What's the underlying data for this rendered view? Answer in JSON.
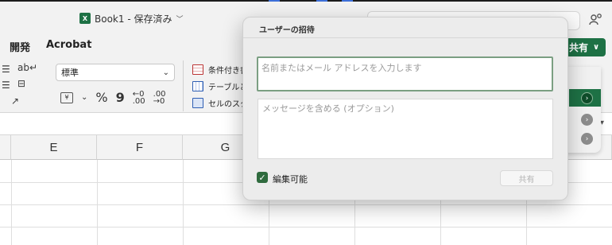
{
  "window": {
    "doc_title": "Book1 - 保存済み",
    "doc_badge": "X"
  },
  "ribbon": {
    "tabs": [
      "開発",
      "Acrobat"
    ],
    "number_format_value": "標準",
    "percent_symbol": "%",
    "comma_symbol": "9",
    "increase_decimal": "←0\n.00",
    "decrease_decimal": ".00\n→0",
    "styles": {
      "conditional": "条件付き書",
      "table": "テーブルと",
      "cell": "セルのスタ"
    },
    "share_label": "共有"
  },
  "grid": {
    "columns": [
      "E",
      "F",
      "G"
    ]
  },
  "invite_dialog": {
    "title": "ユーザーの招待",
    "name_placeholder": "名前またはメール アドレスを入力します",
    "message_placeholder": "メッセージを含める (オプション)",
    "can_edit_label": "編集可能",
    "can_edit_checked": true,
    "share_button_label": "共有"
  },
  "colors": {
    "accent_green": "#1e7145",
    "dialog_bg": "#ececec",
    "input_focus_border": "#7b9f82"
  },
  "icons": {
    "excel_badge": "excel-icon",
    "people": "share-people-icon",
    "checkbox": "checkmark-icon"
  }
}
